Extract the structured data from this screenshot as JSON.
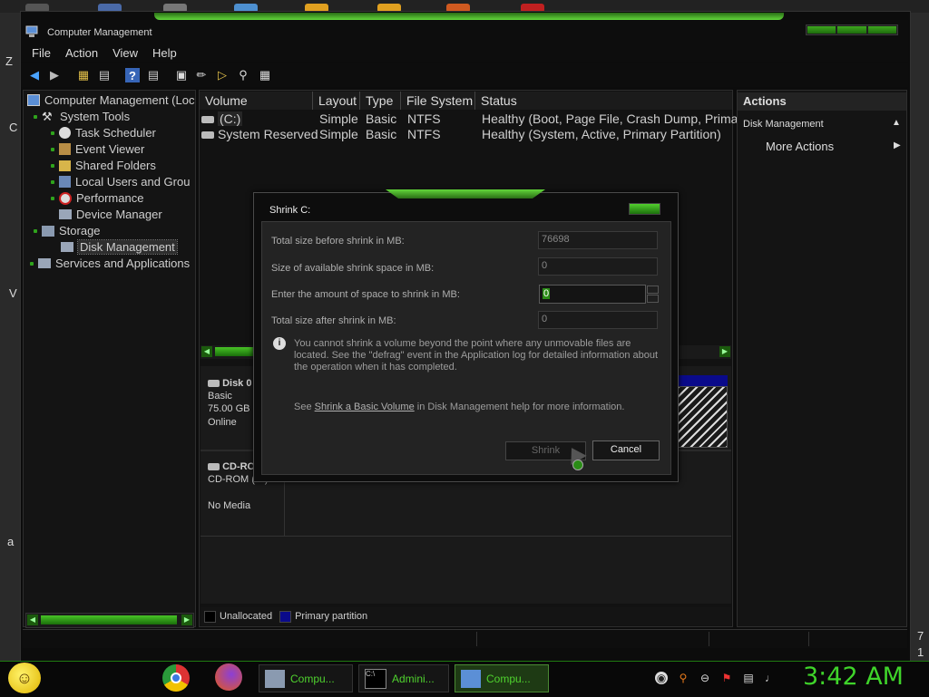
{
  "window": {
    "title": "Computer Management"
  },
  "menu": [
    "File",
    "Action",
    "View",
    "Help"
  ],
  "tree": {
    "root": "Computer Management (Loc",
    "system_tools": "System Tools",
    "task_scheduler": "Task Scheduler",
    "event_viewer": "Event Viewer",
    "shared_folders": "Shared Folders",
    "local_users": "Local Users and Grou",
    "performance": "Performance",
    "device_manager": "Device Manager",
    "storage": "Storage",
    "disk_management": "Disk Management",
    "services": "Services and Applications"
  },
  "volumes": {
    "columns": [
      "Volume",
      "Layout",
      "Type",
      "File System",
      "Status"
    ],
    "rows": [
      [
        "(C:)",
        "Simple",
        "Basic",
        "NTFS",
        "Healthy (Boot, Page File, Crash Dump, Primary"
      ],
      [
        "System Reserved",
        "Simple",
        "Basic",
        "NTFS",
        "Healthy (System, Active, Primary Partition)"
      ]
    ]
  },
  "disks": {
    "disk0": {
      "name": "Disk 0",
      "type": "Basic",
      "size": "75.00 GB",
      "status": "Online"
    },
    "cdrom": {
      "name": "CD-RO",
      "type": "CD-ROM (D:)",
      "media": "No Media"
    }
  },
  "legend": {
    "unallocated": "Unallocated",
    "primary": "Primary partition"
  },
  "actions": {
    "header": "Actions",
    "section": "Disk Management",
    "more": "More Actions"
  },
  "dialog": {
    "title": "Shrink C:",
    "total_before_label": "Total size before shrink in MB:",
    "total_before_value": "76698",
    "available_label": "Size of available shrink space in MB:",
    "available_value": "0",
    "enter_label": "Enter the amount of space to shrink in MB:",
    "enter_value": "0",
    "total_after_label": "Total size after shrink in MB:",
    "total_after_value": "0",
    "info": "You cannot shrink a volume beyond the point where any unmovable files are located. See the \"defrag\" event in the Application log for detailed information about the operation when it has completed.",
    "see_prefix": "See",
    "see_link": "Shrink a Basic Volume",
    "see_suffix": "in Disk Management help for more information.",
    "shrink_button": "Shrink",
    "cancel_button": "Cancel"
  },
  "taskbar": {
    "buttons": [
      "Compu...",
      "Admini...",
      "Compu..."
    ],
    "clock": "3:42 AM"
  },
  "desktop": {
    "chars": [
      "Z",
      "C",
      "V",
      "a",
      "7",
      "1"
    ]
  },
  "colors": {
    "accent": "#3fd42a",
    "primary_partition": "#0a0a8a"
  }
}
